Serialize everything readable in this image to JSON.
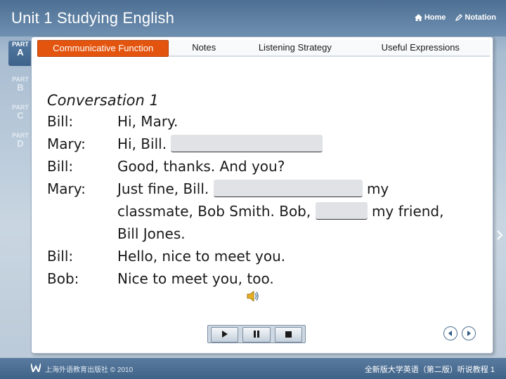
{
  "header": {
    "unit_title": "Unit 1   Studying English",
    "nav": [
      {
        "label": "Home",
        "icon": "home-icon"
      },
      {
        "label": "Notation",
        "icon": "pencil-icon"
      }
    ]
  },
  "sidebar": {
    "parts": [
      {
        "prefix": "PART",
        "letter": "A",
        "active": true
      },
      {
        "prefix": "PART",
        "letter": "B",
        "active": false
      },
      {
        "prefix": "PART",
        "letter": "C",
        "active": false
      },
      {
        "prefix": "PART",
        "letter": "D",
        "active": false
      }
    ]
  },
  "tabs": [
    {
      "label": "Communicative Function",
      "active": true
    },
    {
      "label": "Notes",
      "active": false
    },
    {
      "label": "Listening Strategy",
      "active": false
    },
    {
      "label": "Useful Expressions",
      "active": false
    }
  ],
  "conversation": {
    "title": "Conversation 1",
    "lines": [
      {
        "speaker": "Bill:",
        "text": "Hi, Mary."
      },
      {
        "speaker": "Mary:",
        "text_before": "Hi, Bill. ",
        "text_after": ""
      },
      {
        "speaker": "Bill:",
        "text": "Good, thanks.  And you?"
      },
      {
        "speaker": "Mary:",
        "text_before": "Just fine, Bill. ",
        "text_mid": " my",
        "text_line2": "classmate, Bob Smith. Bob, ",
        "text_after": " my friend,",
        "text_line3": "Bill Jones."
      },
      {
        "speaker": "Bill:",
        "text": "Hello, nice to meet you."
      },
      {
        "speaker": "Bob:",
        "text": "Nice to meet you, too."
      }
    ]
  },
  "player": {
    "buttons": [
      {
        "icon": "play-icon"
      },
      {
        "icon": "pause-icon"
      },
      {
        "icon": "stop-icon"
      }
    ]
  },
  "footer": {
    "left": "上海外语教育出版社 © 2010",
    "right": "全新版大学英语（第二版）听说教程 1"
  },
  "colors": {
    "accent": "#e3550f",
    "header": "#4d6f93",
    "blank": "#e0e2e6"
  }
}
